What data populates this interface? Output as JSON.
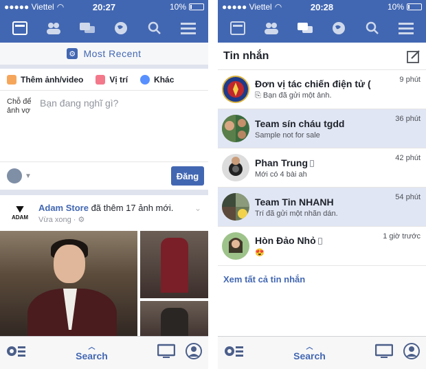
{
  "left": {
    "status": {
      "carrier": "●●●●● Viettel",
      "time": "20:27",
      "battery": "10%"
    },
    "most_recent": "Most Recent",
    "composer": {
      "photo_label": "Thêm ảnh/video",
      "location_label": "Vị trí",
      "more_label": "Khác",
      "avatar_alt": "Chỗ để ảnh vợ",
      "placeholder": "Bạn đang nghĩ gì?",
      "post_button": "Đăng"
    },
    "post": {
      "author": "Adam Store",
      "action": " đã thêm 17 ảnh mới.",
      "time": "Vừa xong · ⚙",
      "logo_text": "ADAM"
    },
    "bottom": {
      "search": "Search"
    }
  },
  "right": {
    "status": {
      "carrier": "●●●●● Viettel",
      "time": "20:28",
      "battery": "10%"
    },
    "header": "Tin nhắn",
    "threads": [
      {
        "name": "Đơn vị tác chiến điện tử (",
        "snippet": "Bạn đã gửi một ảnh.",
        "time": "9 phút",
        "unread": false
      },
      {
        "name": "Team sín cháu tgdd",
        "snippet": "Sample not for sale",
        "time": "36 phút",
        "unread": true
      },
      {
        "name": "Phan Trung",
        "snippet": "Mới có 4 bài ah",
        "time": "42 phút",
        "unread": false
      },
      {
        "name": "Team Tin NHANH",
        "snippet": "Trí đã gửi một nhãn dán.",
        "time": "54 phút",
        "unread": true
      },
      {
        "name": "Hòn Đảo Nhỏ",
        "snippet": "😍",
        "time": "1 giờ trước",
        "unread": false
      }
    ],
    "see_all": "Xem tất cả tin nhắn",
    "bottom": {
      "search": "Search"
    }
  },
  "colors": {
    "brand": "#4267b2",
    "unread_bg": "#e1e6f4"
  }
}
